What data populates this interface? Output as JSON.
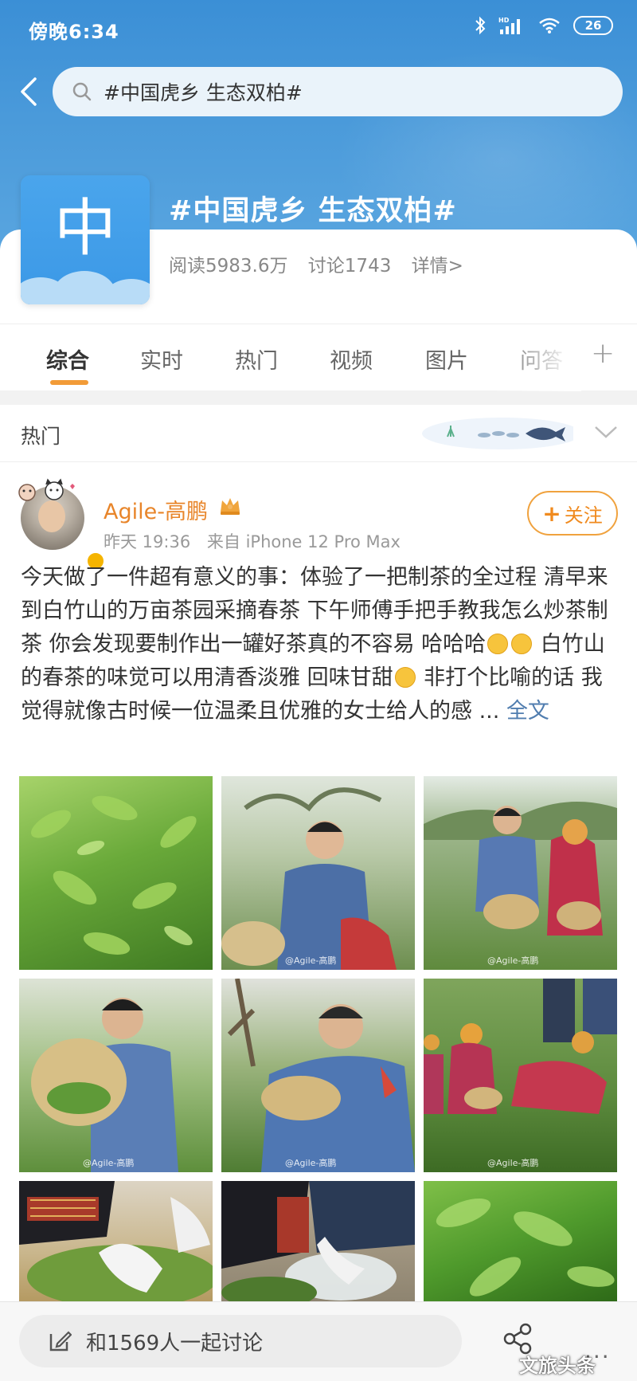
{
  "status_bar": {
    "time": "傍晚6:34",
    "signal_label": "HD",
    "battery": "26"
  },
  "search": {
    "query": "#中国虎乡 生态双柏#"
  },
  "topic": {
    "avatar_char": "中",
    "title": "#中国虎乡 生态双柏#",
    "reads": "阅读5983.6万",
    "discussions": "讨论1743",
    "details": "详情>"
  },
  "tabs": [
    {
      "label": "综合"
    },
    {
      "label": "实时"
    },
    {
      "label": "热门"
    },
    {
      "label": "视频"
    },
    {
      "label": "图片"
    },
    {
      "label": "问答"
    }
  ],
  "section": {
    "label": "热门"
  },
  "post": {
    "author": "Agile-高鹏",
    "time": "昨天 19:36",
    "source": "来自 iPhone 12 Pro Max",
    "follow_label": "关注",
    "text_1": "今天做了一件超有意义的事：体验了一把制茶的全过程 清早来到白竹山的万亩茶园采摘春茶  下午师傅手把手教我怎么炒茶制茶 你会发现要制作出一罐好茶真的不容易 哈哈哈",
    "text_2": "  白竹山的春茶的味觉可以用清香淡雅 回味甘甜",
    "text_3": "  非打个比喻的话 我觉得就像古时候一位温柔且优雅的女士给人的感 ...",
    "more": "全文",
    "photos": [
      {
        "name": "photo-tea-leaves",
        "watermark": ""
      },
      {
        "name": "photo-man-tasting-leaf",
        "watermark": "@Agile-高鹏"
      },
      {
        "name": "photo-picking-with-local-woman",
        "watermark": "@Agile-高鹏"
      },
      {
        "name": "photo-man-holding-basket",
        "watermark": "@Agile-高鹏"
      },
      {
        "name": "photo-man-picking-tea",
        "watermark": "@Agile-高鹏"
      },
      {
        "name": "photo-women-picking-tea",
        "watermark": "@Agile-高鹏"
      },
      {
        "name": "photo-hands-in-basket",
        "watermark": ""
      },
      {
        "name": "photo-steaming-tea",
        "watermark": ""
      },
      {
        "name": "photo-tea-closeup",
        "watermark": ""
      }
    ]
  },
  "bottom": {
    "comment_placeholder": "和1569人一起讨论",
    "brand": "文旅头条",
    "more": "..."
  },
  "colors": {
    "header_blue": "#4a9ada",
    "accent_orange": "#f29b38",
    "link_blue": "#507daf"
  }
}
